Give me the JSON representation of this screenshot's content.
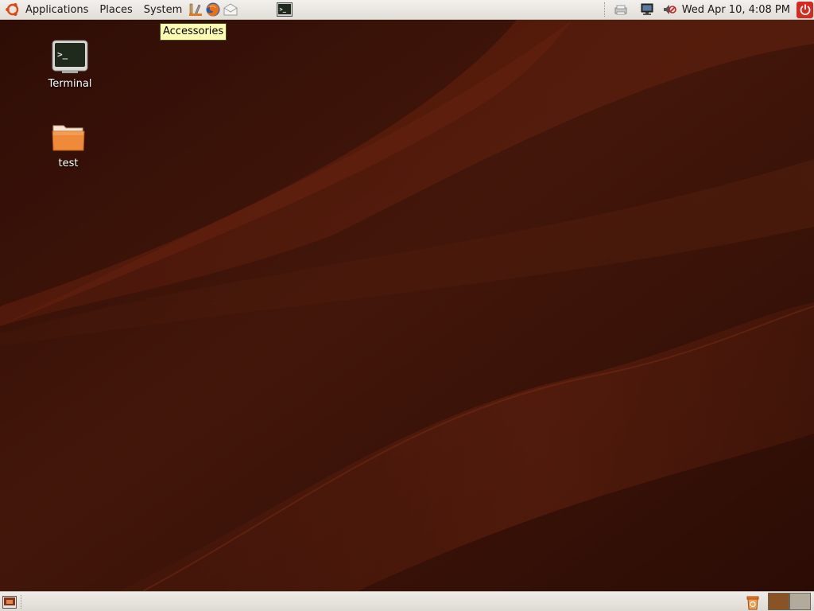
{
  "top_panel": {
    "menus": [
      {
        "label": "Applications",
        "icon": "ubuntu-logo-icon"
      },
      {
        "label": "Places"
      },
      {
        "label": "System"
      }
    ],
    "launchers": [
      "accessories-icon",
      "firefox-icon",
      "mail-icon"
    ],
    "taskbar_items": [
      "terminal-window-icon"
    ],
    "tray_icons": [
      "printer-icon",
      "network-icon",
      "volume-muted-icon"
    ],
    "clock": "Wed Apr 10,  4:08 PM",
    "power_icon": "power-icon"
  },
  "tooltip": {
    "text": "Accessories"
  },
  "desktop": {
    "icons": [
      {
        "label": "Terminal",
        "icon": "terminal-icon"
      },
      {
        "label": "test",
        "icon": "folder-icon"
      }
    ]
  },
  "bottom_panel": {
    "show_desktop_icon": "show-desktop-icon",
    "trash_icon": "trash-icon",
    "workspaces": [
      {
        "color": "#8a5326",
        "active": true
      },
      {
        "color": "#b3aa9e",
        "active": false
      }
    ]
  },
  "colors": {
    "wallpaper": "#3d1508",
    "panel": "#e7e4df",
    "tooltip_bg": "#fbfbb2",
    "accent": "#dd4814"
  }
}
